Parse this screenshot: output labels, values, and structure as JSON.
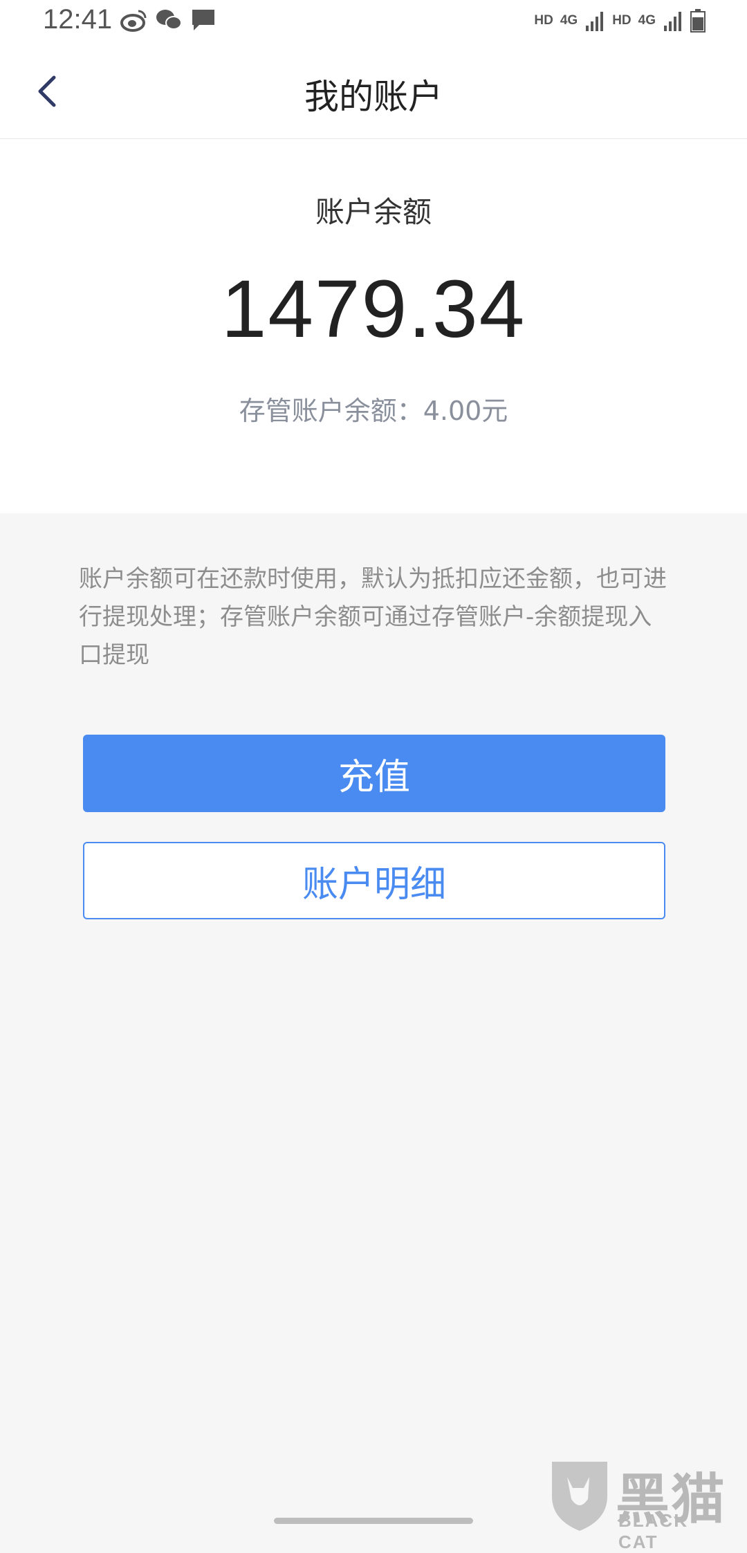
{
  "status_bar": {
    "time": "12:41",
    "left_icons": [
      "weibo-icon",
      "wechat-icon",
      "message-icon"
    ],
    "sim1_hd": "HD",
    "sim1_net": "4G",
    "sim2_hd": "HD",
    "sim2_net": "4G"
  },
  "header": {
    "title": "我的账户",
    "back_icon": "chevron-left-icon"
  },
  "balance": {
    "label": "账户余额",
    "amount": "1479.34",
    "escrow_text": "存管账户余额：4.00元"
  },
  "note": "账户余额可在还款时使用，默认为抵扣应还金额，也可进行提现处理；存管账户余额可通过存管账户-余额提现入口提现",
  "actions": {
    "recharge_label": "充值",
    "details_label": "账户明细"
  },
  "watermark": {
    "name": "黑猫",
    "sub": "BLACK CAT"
  },
  "colors": {
    "accent": "#4a8bf1",
    "background": "#f6f6f6"
  }
}
